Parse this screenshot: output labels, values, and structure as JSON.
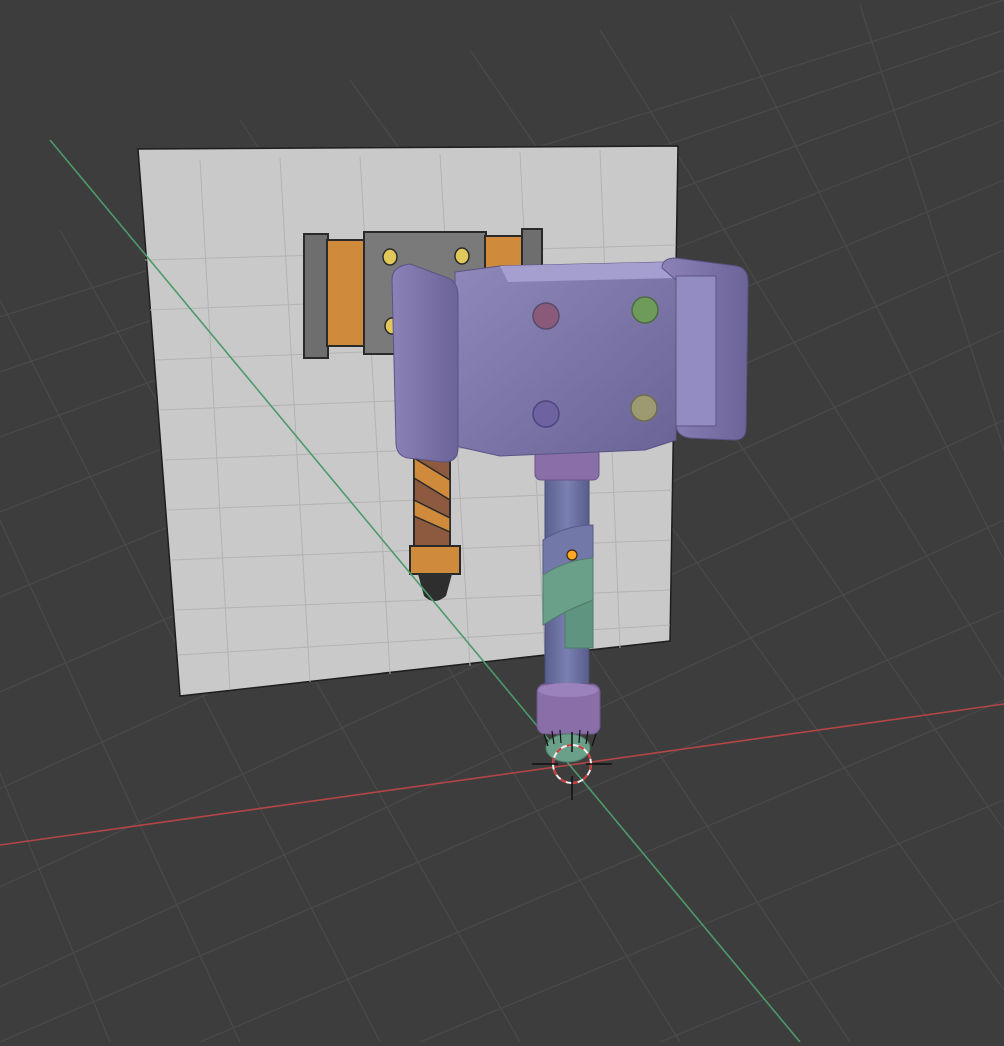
{
  "viewport": {
    "background": "#3d3d3d",
    "grid_color": "#4a4a4a",
    "x_axis_color": "#b34545",
    "y_axis_color": "#4d9a6a"
  },
  "scene": {
    "reference_image": {
      "plane_color": "#c8c8c8",
      "plane_border": "#1f1f1f",
      "sketch_colors": [
        "#7a7a7a",
        "#cf8a3b",
        "#e2c85a",
        "#8d5a3f",
        "#2e2e2e"
      ]
    },
    "hammer": {
      "head_color": "#7f78a8",
      "head_highlight": "#9e98c8",
      "cap_color": "#a090c4",
      "handle_color": "#6c71a0",
      "collar_color": "#8a6ea8",
      "wrap_color": "#6aa08a",
      "rivet_colors": [
        "#8a5a7a",
        "#6e9a5a",
        "#6e62a0",
        "#9c9a70"
      ],
      "origin_point_color": "#ffaa22"
    },
    "cursor": {
      "ring_color": "#d23a3a",
      "ring_alt_color": "#f0f0f0",
      "crosshair_color": "#101010"
    }
  }
}
